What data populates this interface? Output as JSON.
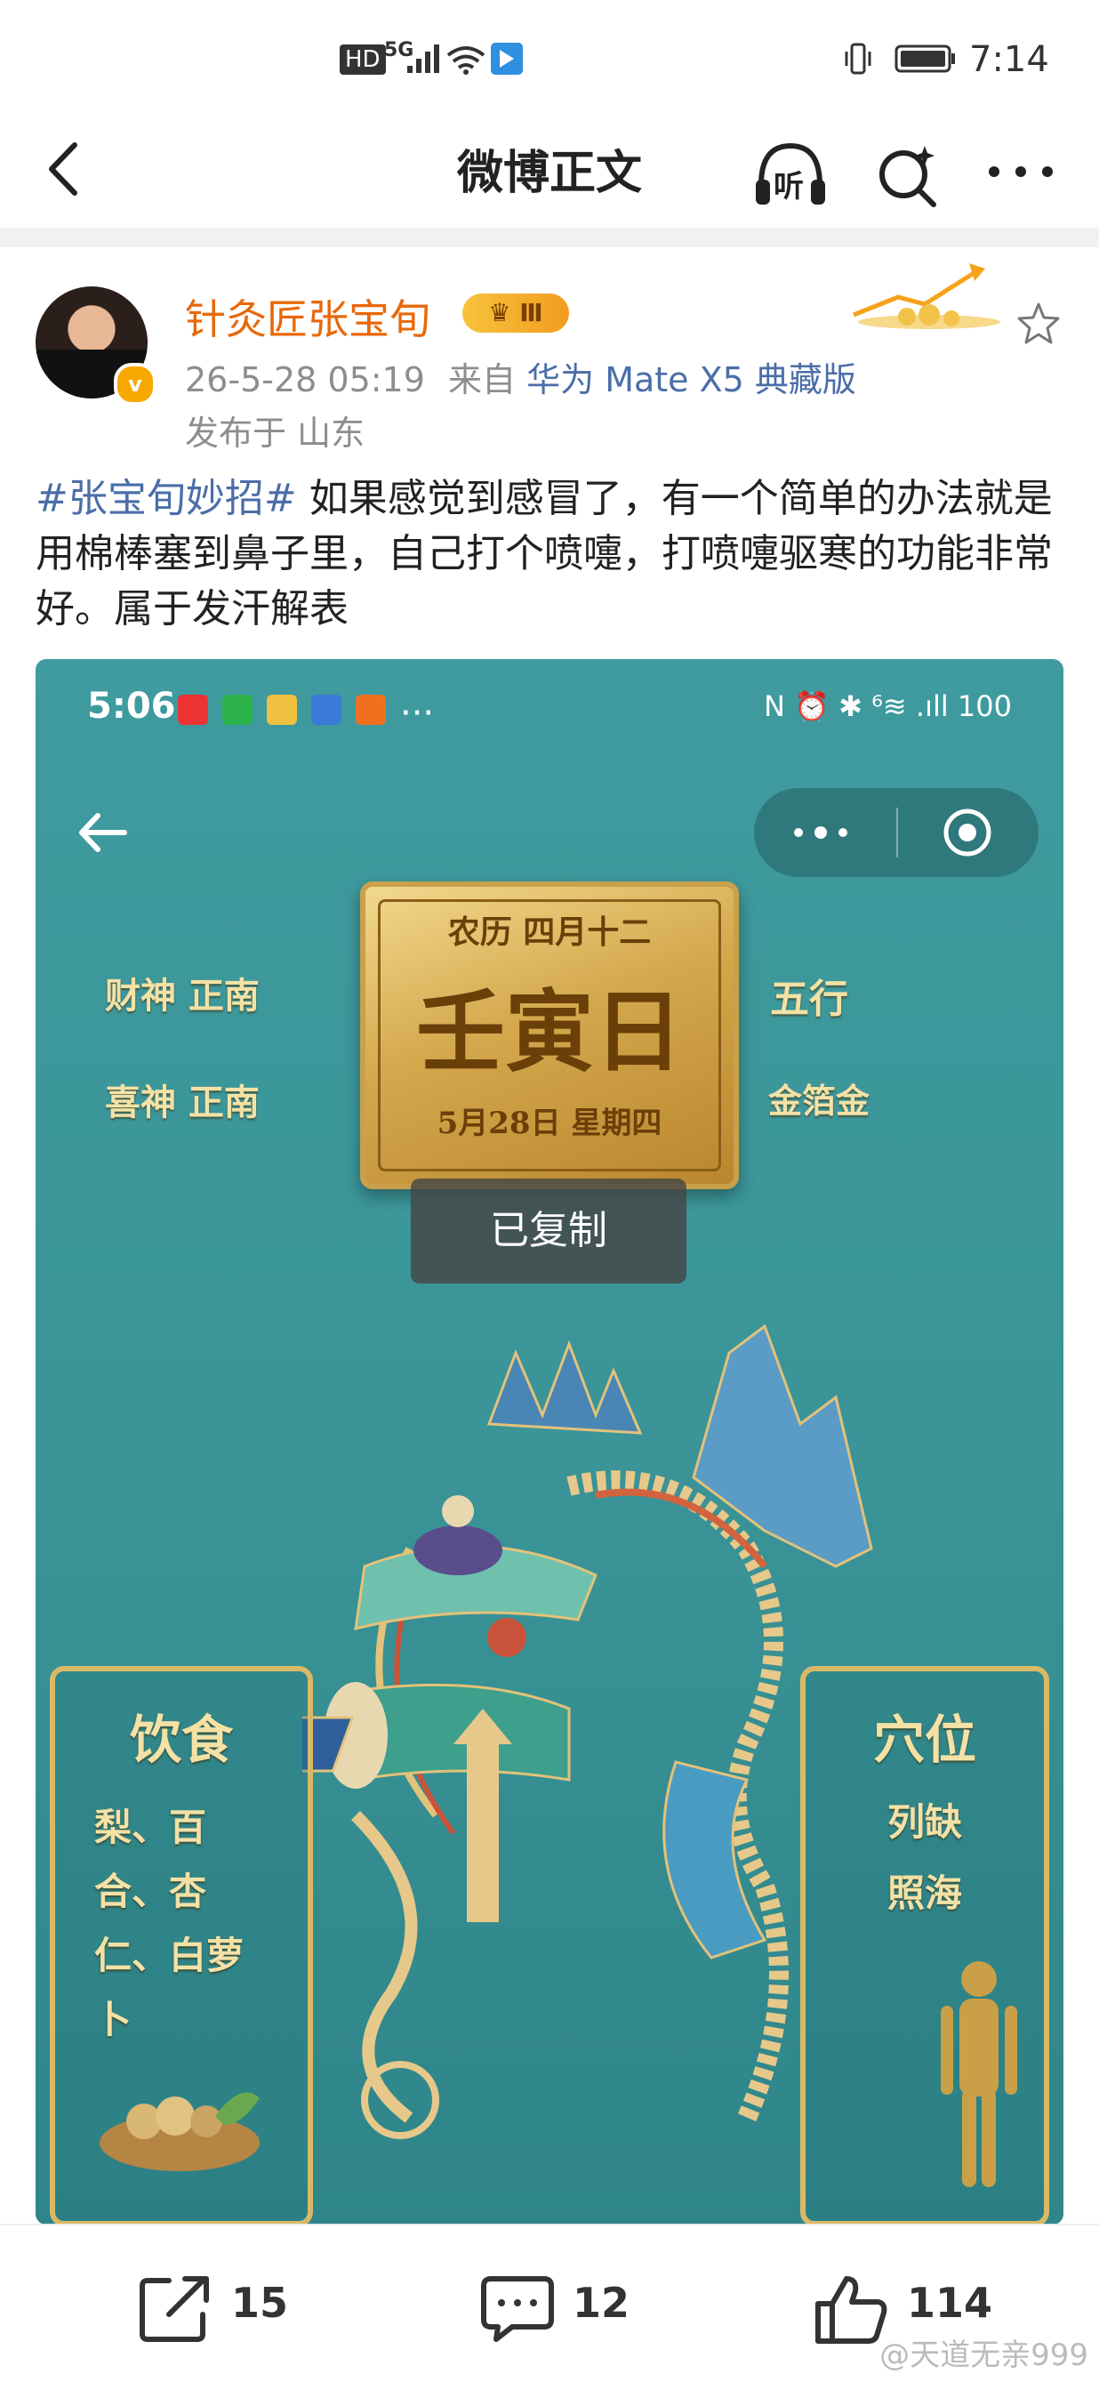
{
  "status_bar": {
    "network": "HD",
    "signal": "5G",
    "time": "7:14"
  },
  "top_bar": {
    "title": "微博正文",
    "listen_label": "听"
  },
  "post": {
    "username": "针灸匠张宝旬",
    "rank_badge": "Ⅲ",
    "datetime": "26-5-28 05:19",
    "source_prefix": "来自",
    "source_device": "华为 Mate X5 典藏版",
    "location": "发布于 山东",
    "hashtag": "#张宝旬妙招#",
    "text": " 如果感觉到感冒了，有一个简单的办法就是用棉棒塞到鼻子里，自己打个喷嚏，打喷嚏驱寒的功能非常好。属于发汗解表"
  },
  "image": {
    "status_time": "5:06",
    "status_icons": "N ⏰ ✱ ⁶≋ .ıll 100",
    "plaque_line1": "农历 四月十二",
    "plaque_big": "壬寅日",
    "plaque_line3": "5月28日 星期四",
    "left_top": "财神  正南",
    "left_bottom": "喜神  正南",
    "right_top": "五行",
    "right_bottom": "金箔金",
    "toast": "已复制",
    "panel_left_title": "饮食",
    "panel_left_items": [
      "梨、百",
      "合、杏",
      "仁、白萝",
      "卜"
    ],
    "panel_right_title": "穴位",
    "panel_right_items": [
      "列缺",
      "照海"
    ]
  },
  "actions": {
    "repost_count": "15",
    "comment_count": "12",
    "like_count": "114",
    "watermark": "@天道无亲999"
  },
  "colors": {
    "username": "#e8680a",
    "link": "#4a6ea8",
    "poster_bg": "#3f9b9f",
    "gold": "#d4a84d"
  }
}
